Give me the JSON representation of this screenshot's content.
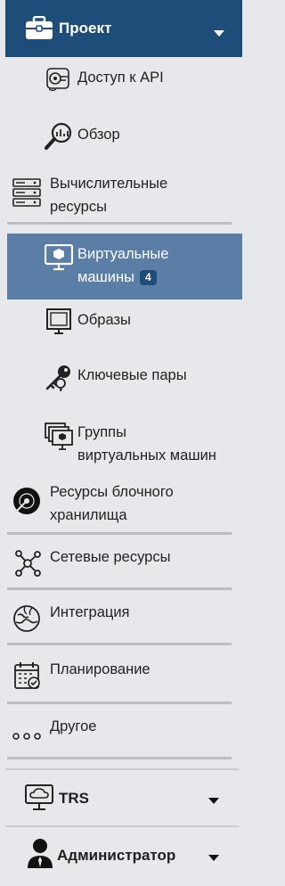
{
  "header": {
    "title": "Проект",
    "icon": "briefcase-icon"
  },
  "items": {
    "api_access": {
      "label": "Доступ к API",
      "icon": "api-access-icon"
    },
    "overview": {
      "label": "Обзор",
      "icon": "overview-magnifier-icon"
    },
    "compute": {
      "line1": "Вычислительные",
      "line2": "ресурсы",
      "icon": "server-rack-icon"
    },
    "vms": {
      "line1": "Виртуальные",
      "line2": "машины",
      "badge": "4",
      "icon": "vm-monitor-icon"
    },
    "images": {
      "label": "Образы",
      "icon": "monitor-icon"
    },
    "keypairs": {
      "label": "Ключевые пары",
      "icon": "keys-icon"
    },
    "vm_groups": {
      "line1": "Группы",
      "line2": "виртуальных машин",
      "icon": "vm-groups-icon"
    },
    "block_storage": {
      "line1": "Ресурсы блочного",
      "line2": "хранилища",
      "icon": "disk-icon"
    },
    "network": {
      "label": "Сетевые ресурсы",
      "icon": "network-nodes-icon"
    },
    "integration": {
      "label": "Интеграция",
      "icon": "puzzle-globe-icon"
    },
    "scheduling": {
      "label": "Планирование",
      "icon": "calendar-check-icon"
    },
    "other": {
      "label": "Другое",
      "icon": "more-dots-icon"
    }
  },
  "sections": {
    "trs": {
      "label": "TRS",
      "icon": "cloud-monitor-icon"
    },
    "admin": {
      "label": "Администратор",
      "icon": "admin-user-icon"
    }
  },
  "colors": {
    "header_bg": "#1f4d7a",
    "active_bg": "#5b7ea6",
    "sidebar_bg": "#e6e8ec"
  }
}
